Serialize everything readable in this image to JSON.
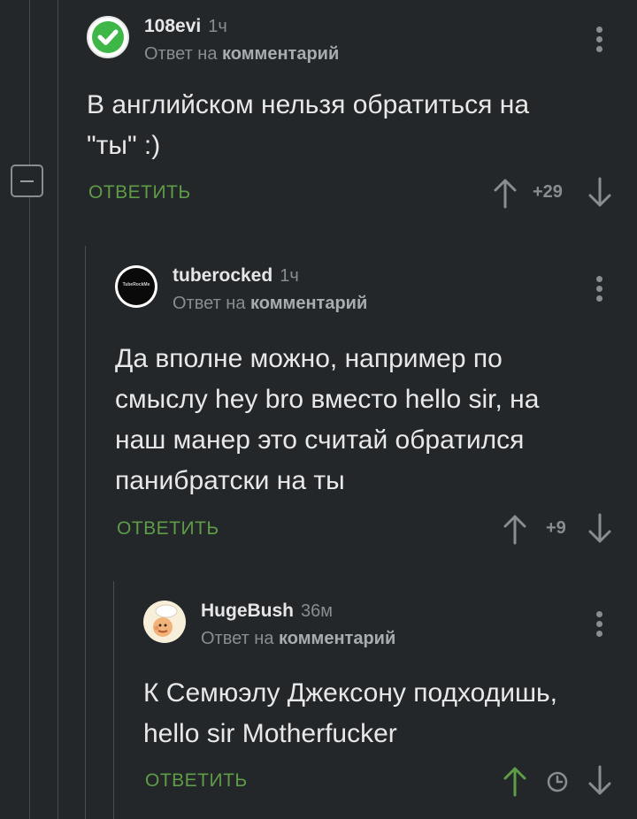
{
  "colors": {
    "background": "#24272a",
    "accent_green": "#5e9c47",
    "muted_text": "#8a8d90",
    "main_text": "#e8e8e8"
  },
  "comments": [
    {
      "author": "108evi",
      "time": "1ч",
      "reply_prefix": "Ответ на",
      "reply_target": "комментарий",
      "text_lines": [
        "В английском нельзя обратиться на",
        "\"ты\" :)"
      ],
      "reply_label": "ОТВЕТИТЬ",
      "score": "+29",
      "avatar_icon": "check-badge-icon"
    },
    {
      "author": "tuberocked",
      "time": "1ч",
      "reply_prefix": "Ответ на",
      "reply_target": "комментарий",
      "avatar_text": "TubeRockMe",
      "text_lines": [
        "Да вполне можно, например по",
        "смыслу hey bro вместо hello sir, на",
        "наш манер это считай обратился",
        "панибратски на ты"
      ],
      "reply_label": "ОТВЕТИТЬ",
      "score": "+9"
    },
    {
      "author": "HugeBush",
      "time": "36м",
      "reply_prefix": "Ответ на",
      "reply_target": "комментарий",
      "text_lines": [
        "К Семюэлу Джексону подходишь,",
        "hello sir Motherfucker"
      ],
      "reply_label": "ОТВЕТИТЬ",
      "avatar_icon": "chef-cartoon-avatar",
      "vote_state": "upvoted"
    }
  ]
}
